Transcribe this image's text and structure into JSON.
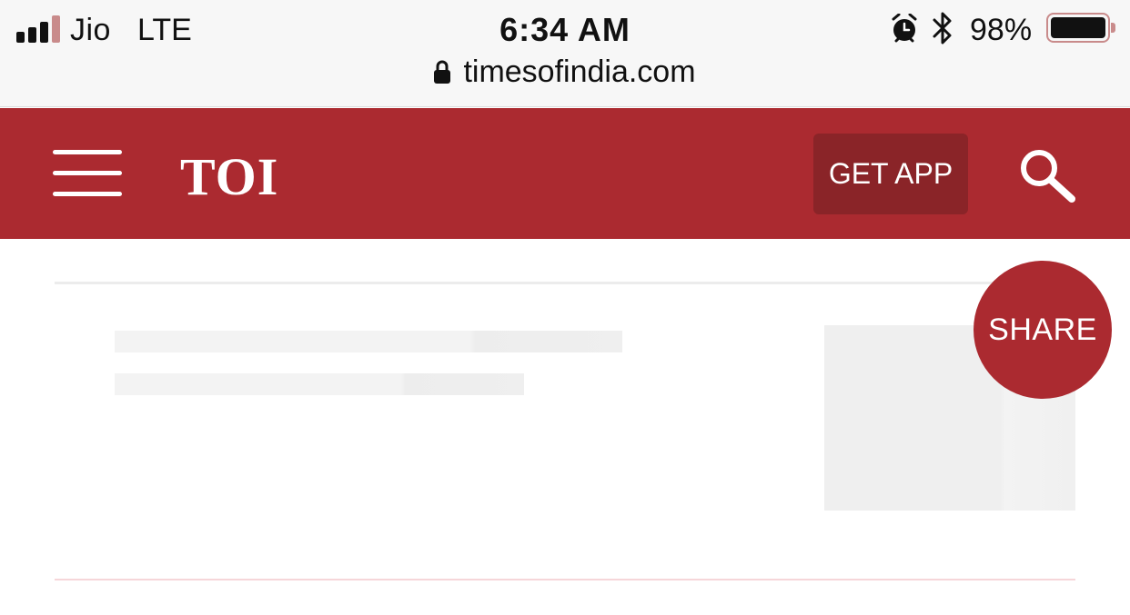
{
  "status_bar": {
    "carrier": "Jio",
    "network": "LTE",
    "time": "6:34 AM",
    "battery_percent": "98%",
    "signal_bars_active": 3,
    "signal_bars_total": 4,
    "icons": [
      "signal-icon",
      "alarm-icon",
      "bluetooth-icon",
      "battery-icon"
    ]
  },
  "browser": {
    "url": "timesofindia.com",
    "icon": "lock-icon"
  },
  "header": {
    "logo": "TOI",
    "get_app_label": "GET APP",
    "menu_icon": "hamburger-menu-icon",
    "search_icon": "search-icon",
    "brand_color": "#ab2a30",
    "button_color": "#8a2428"
  },
  "share": {
    "label": "SHARE"
  },
  "content": {
    "state": "loading-placeholder"
  }
}
